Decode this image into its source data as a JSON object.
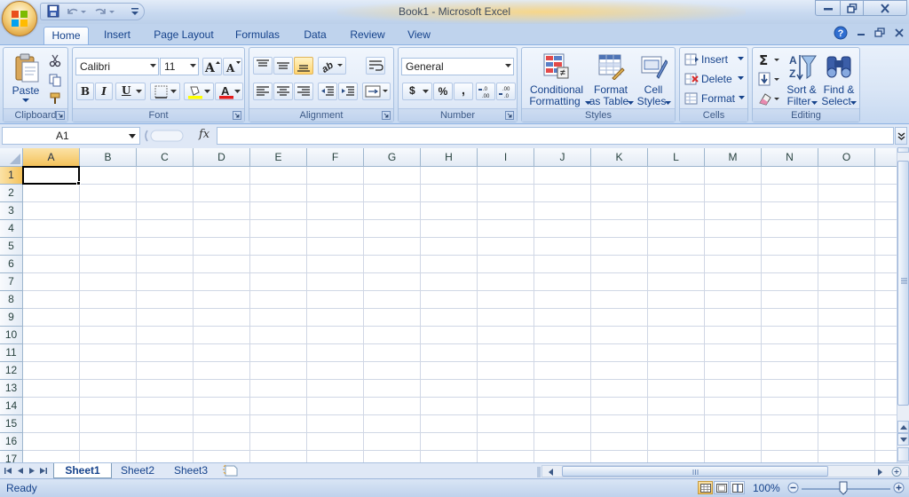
{
  "window": {
    "title": "Book1 - Microsoft Excel",
    "buttons": [
      "minimize-icon",
      "restore-icon",
      "close-icon"
    ]
  },
  "tabs": [
    {
      "label": "Home",
      "active": true
    },
    {
      "label": "Insert"
    },
    {
      "label": "Page Layout"
    },
    {
      "label": "Formulas"
    },
    {
      "label": "Data"
    },
    {
      "label": "Review"
    },
    {
      "label": "View"
    }
  ],
  "ribbon": {
    "clipboard": {
      "label": "Clipboard",
      "paste": "Paste"
    },
    "font": {
      "label": "Font",
      "name": "Calibri",
      "size": "11",
      "bold": "B",
      "italic": "I",
      "underline": "U"
    },
    "alignment": {
      "label": "Alignment"
    },
    "number": {
      "label": "Number",
      "format": "General",
      "currency": "$",
      "percent": "%",
      "comma": ","
    },
    "styles": {
      "label": "Styles",
      "conditional_line1": "Conditional",
      "conditional_line2": "Formatting",
      "table_line1": "Format",
      "table_line2": "as Table",
      "cell_line1": "Cell",
      "cell_line2": "Styles"
    },
    "cells": {
      "label": "Cells",
      "insert": "Insert",
      "delete": "Delete",
      "format": "Format"
    },
    "editing": {
      "label": "Editing",
      "sort_line1": "Sort &",
      "sort_line2": "Filter",
      "find_line1": "Find &",
      "find_line2": "Select"
    }
  },
  "formula_bar": {
    "name_box": "A1",
    "fx": "fx",
    "value": ""
  },
  "grid": {
    "columns": [
      "A",
      "B",
      "C",
      "D",
      "E",
      "F",
      "G",
      "H",
      "I",
      "J",
      "K",
      "L",
      "M",
      "N",
      "O"
    ],
    "rows": [
      "1",
      "2",
      "3",
      "4",
      "5",
      "6",
      "7",
      "8",
      "9",
      "10",
      "11",
      "12",
      "13",
      "14",
      "15",
      "16",
      "17"
    ],
    "selected_column": "A",
    "selected_row": "1"
  },
  "sheets": [
    {
      "label": "Sheet1",
      "active": true
    },
    {
      "label": "Sheet2"
    },
    {
      "label": "Sheet3"
    }
  ],
  "status": {
    "text": "Ready",
    "zoom": "100%"
  },
  "colors": {
    "accent": "#15428b",
    "ribbon": "#dfe8f6",
    "selection": "#f4c25b"
  }
}
